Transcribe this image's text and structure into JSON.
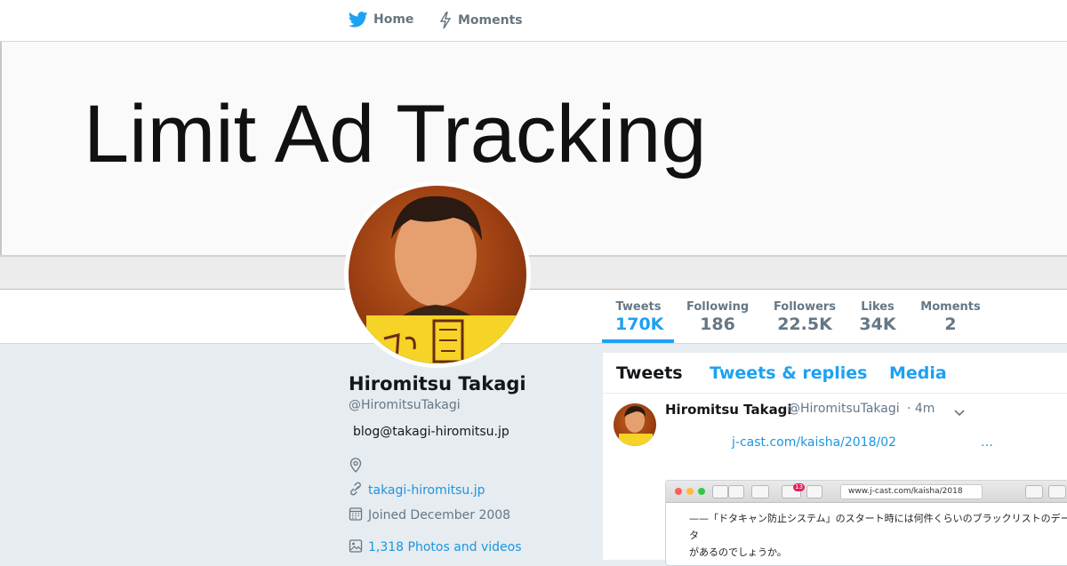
{
  "nav": {
    "home_label": "Home",
    "moments_label": "Moments"
  },
  "banner": {
    "text": "Limit Ad Tracking"
  },
  "stats": [
    {
      "label": "Tweets",
      "value": "170K"
    },
    {
      "label": "Following",
      "value": "186"
    },
    {
      "label": "Followers",
      "value": "22.5K"
    },
    {
      "label": "Likes",
      "value": "34K"
    },
    {
      "label": "Moments",
      "value": "2"
    }
  ],
  "profile": {
    "name": "Hiromitsu Takagi",
    "handle": "@HiromitsuTakagi",
    "bio": "blog@takagi-hiromitsu.jp",
    "website": "takagi-hiromitsu.jp",
    "joined": "Joined December 2008",
    "photos": "1,318 Photos and videos"
  },
  "timeline": {
    "tabs": [
      "Tweets",
      "Tweets & replies",
      "Media"
    ]
  },
  "tweet": {
    "name": "Hiromitsu Takagi",
    "handle": "@HiromitsuTakagi",
    "time": "· 4m",
    "link": "j-cast.com/kaisha/2018/02",
    "ellipsis": "…",
    "screenshot": {
      "url": "www.j-cast.com/kaisha/2018",
      "badge": "13",
      "line1": "——「ドタキャン防止システム」のスタート時には何件くらいのブラックリストのデータ",
      "line2": "があるのでしょうか。"
    }
  },
  "colors": {
    "accent": "#1da1f2",
    "link": "#1b95e0",
    "muted": "#657786"
  }
}
